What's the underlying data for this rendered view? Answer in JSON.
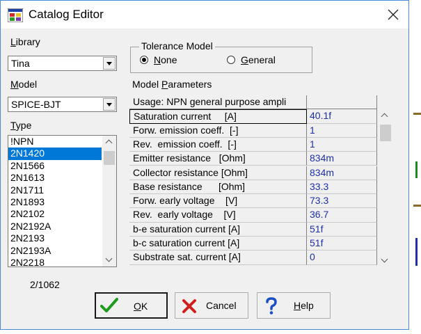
{
  "window": {
    "title": "Catalog Editor"
  },
  "library": {
    "label": "Library",
    "selected": "Tina"
  },
  "model": {
    "label": "Model",
    "selected": "SPICE-BJT"
  },
  "type": {
    "label": "Type",
    "items": [
      "!NPN",
      "2N1420",
      "2N1566",
      "2N1613",
      "2N1711",
      "2N1893",
      "2N2102",
      "2N2192A",
      "2N2193",
      "2N2193A",
      "2N2218"
    ],
    "selected_index": 1,
    "count": "2/1062"
  },
  "tolerance": {
    "title": "Tolerance Model",
    "options": [
      "None",
      "General"
    ],
    "selected": "None"
  },
  "params": {
    "title": "Model Parameters",
    "usage": "Usage: NPN general purpose ampli",
    "rows": [
      {
        "name": "Saturation current     [A]",
        "value": "40.1f"
      },
      {
        "name": "Forw. emission coeff.  [-]",
        "value": "1"
      },
      {
        "name": "Rev.  emission coeff.  [-]",
        "value": "1"
      },
      {
        "name": "Emitter resistance   [Ohm]",
        "value": "834m"
      },
      {
        "name": "Collector resistance [Ohm]",
        "value": "834m"
      },
      {
        "name": "Base resistance      [Ohm]",
        "value": "33.3"
      },
      {
        "name": "Forw. early voltage    [V]",
        "value": "73.3"
      },
      {
        "name": "Rev.  early voltage    [V]",
        "value": "36.7"
      },
      {
        "name": "b-e saturation current [A]",
        "value": "51f"
      },
      {
        "name": "b-c saturation current [A]",
        "value": "51f"
      },
      {
        "name": "Substrate sat. current [A]",
        "value": "0"
      }
    ]
  },
  "buttons": {
    "ok": "OK",
    "cancel": "Cancel",
    "help": "Help"
  },
  "colors": {
    "selection": "#0078d7",
    "value_text": "#1e2fa8",
    "ok_check": "#1e9a1e",
    "cancel_x": "#d21e1e",
    "help_q": "#1c4fc4"
  },
  "icons": [
    "app-icon",
    "close-icon",
    "checkmark-icon",
    "cross-icon",
    "question-icon"
  ]
}
